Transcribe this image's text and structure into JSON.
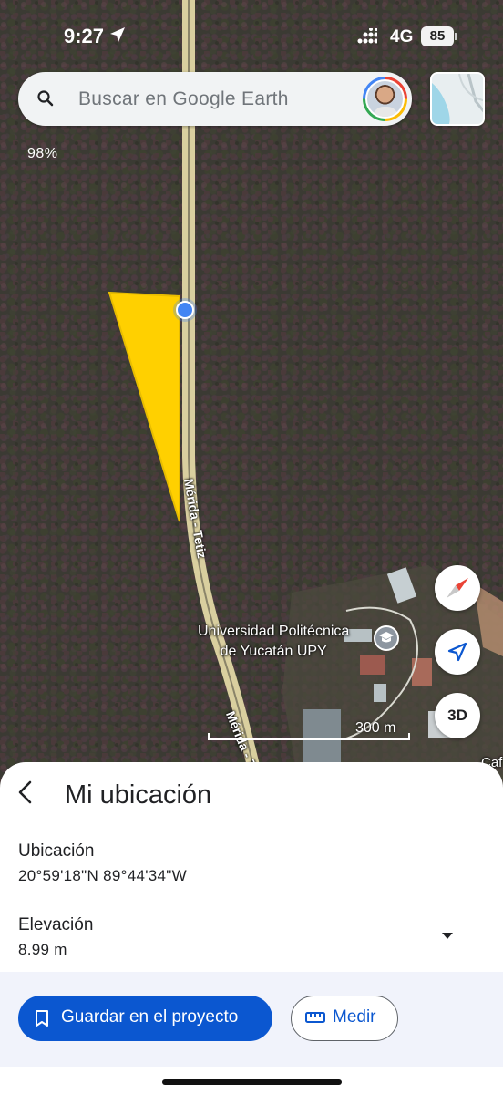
{
  "status_bar": {
    "time": "9:27",
    "network": "4G",
    "battery": "85"
  },
  "search": {
    "placeholder": "Buscar en Google Earth"
  },
  "map": {
    "zoom_percent": "98%",
    "place_label_line1": "Universidad Politécnica",
    "place_label_line2": "de Yucatán UPY",
    "road_label_1": "Mérida - Tetiz",
    "road_label_2": "Mérida - T",
    "edge_label": "Caf",
    "scale_label": "300 m",
    "polygon_color": "#FFD000",
    "location_dot_color": "#4285F4"
  },
  "controls": {
    "three_d_label": "3D"
  },
  "panel": {
    "title": "Mi ubicación",
    "location_label": "Ubicación",
    "location_value": "20°59'18\"N 89°44'34\"W",
    "elevation_label": "Elevación",
    "elevation_value": "8.99 m",
    "save_button": "Guardar en el proyecto",
    "measure_button": "Medir"
  },
  "colors": {
    "accent": "#0B57D0",
    "sheet_footer": "#F1F3FB"
  }
}
